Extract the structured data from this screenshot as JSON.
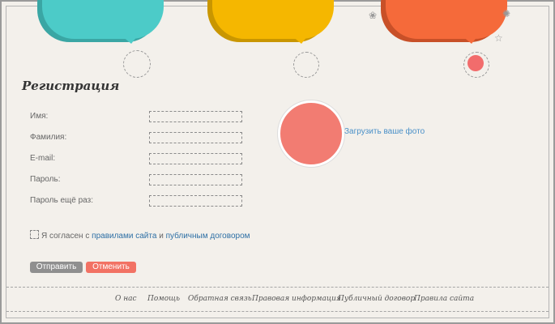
{
  "page": {
    "title": "Регистрация"
  },
  "form": {
    "fields": [
      {
        "label": "Имя:",
        "value": ""
      },
      {
        "label": "Фамилия:",
        "value": ""
      },
      {
        "label": "E-mail:",
        "value": ""
      },
      {
        "label": "Пароль:",
        "value": ""
      },
      {
        "label": "Пароль ещё раз:",
        "value": ""
      }
    ],
    "upload_label": "Загрузить ваше фото",
    "agree_text": "Я согласен с",
    "agree_rules_link": "правилами сайта",
    "agree_and": "и",
    "agree_contract_link": "публичным договором",
    "submit_label": "Отправить",
    "cancel_label": "Отменить"
  },
  "footer": {
    "links": [
      "О нас",
      "Помощь",
      "Обратная связь",
      "Правовая информация",
      "Публичный договор",
      "Правила сайта"
    ]
  },
  "colors": {
    "teal": "#4ccbc8",
    "yellow": "#f5b700",
    "orange": "#f56a3a",
    "photo": "#f27c72",
    "cancel": "#f27264",
    "submit": "#8f8f8f",
    "link": "#2d6fa5"
  }
}
